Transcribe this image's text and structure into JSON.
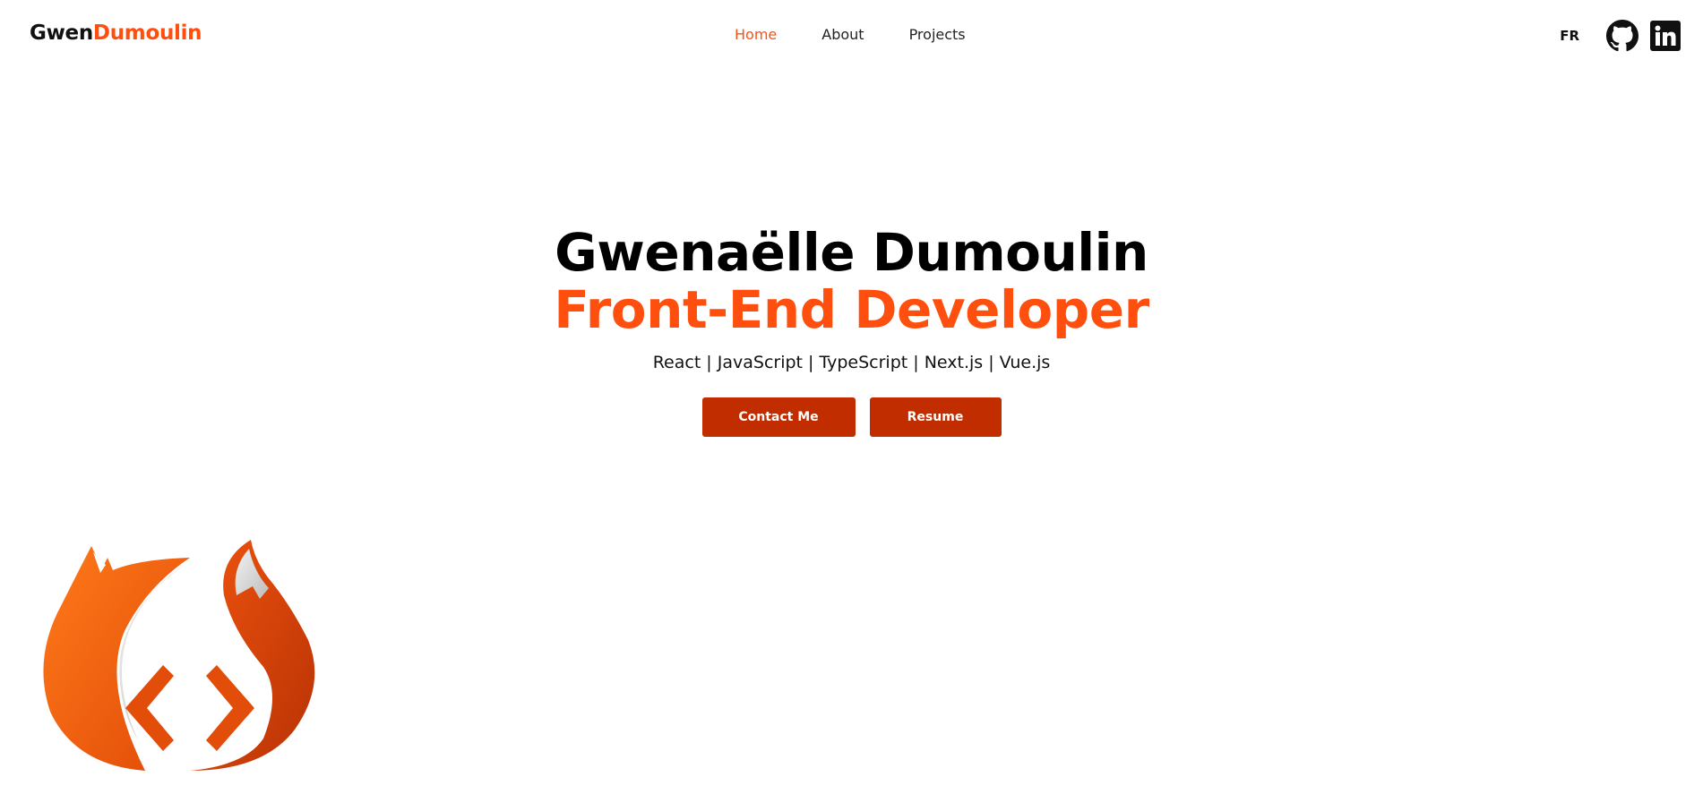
{
  "brand": {
    "first": "Gwen",
    "last": "Dumoulin"
  },
  "nav": {
    "items": [
      {
        "label": "Home",
        "active": true
      },
      {
        "label": "About",
        "active": false
      },
      {
        "label": "Projects",
        "active": false
      }
    ]
  },
  "header": {
    "lang_label": "FR",
    "social_icons": [
      "github-icon",
      "linkedin-icon"
    ]
  },
  "hero": {
    "name": "Gwenaëlle Dumoulin",
    "role": "Front-End Developer",
    "stack": "React | JavaScript | TypeScript | Next.js | Vue.js",
    "contact_label": "Contact Me",
    "resume_label": "Resume"
  },
  "colors": {
    "accent": "#ff4f0f",
    "button": "#c22d00",
    "text": "#111111"
  }
}
